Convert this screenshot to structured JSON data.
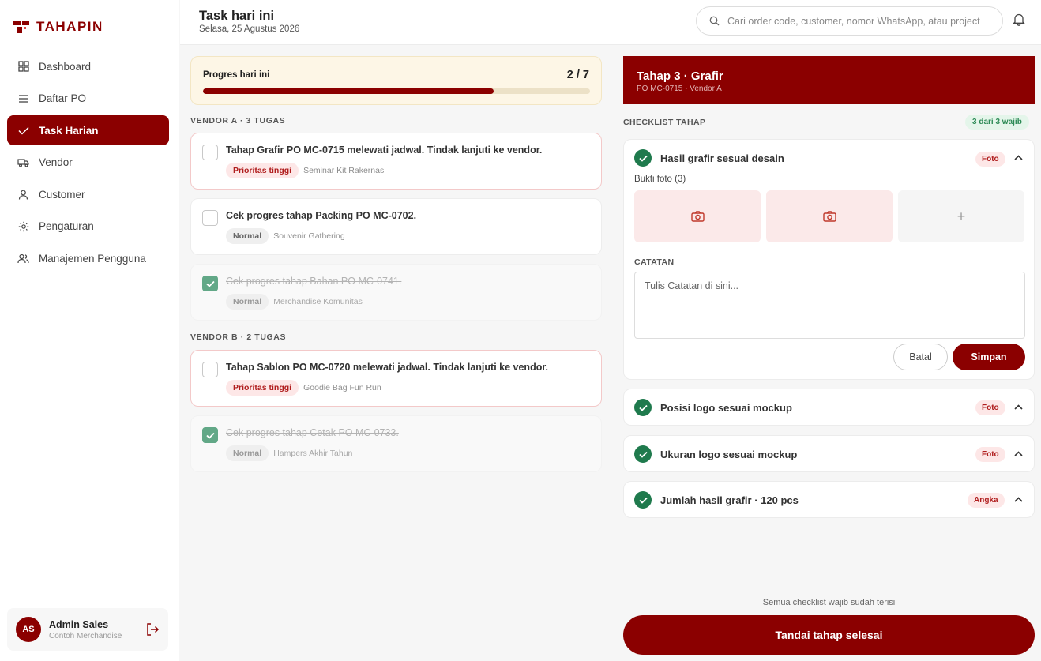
{
  "brand": {
    "name": "TAHAPIN",
    "color": "#8b0000"
  },
  "sidebar": {
    "items": [
      {
        "label": "Dashboard",
        "icon": "grid-icon"
      },
      {
        "label": "Daftar PO",
        "icon": "list-icon"
      },
      {
        "label": "Task Harian",
        "icon": "check-icon",
        "active": true
      },
      {
        "label": "Vendor",
        "icon": "truck-icon"
      },
      {
        "label": "Customer",
        "icon": "user-icon"
      },
      {
        "label": "Pengaturan",
        "icon": "gear-icon"
      },
      {
        "label": "Manajemen Pengguna",
        "icon": "users-icon"
      }
    ],
    "user": {
      "initials": "AS",
      "name": "Admin Sales",
      "org": "Contoh Merchandise"
    }
  },
  "header": {
    "title": "Task hari ini",
    "date": "Selasa, 25 Agustus 2026",
    "search_placeholder": "Cari order code, customer, nomor WhatsApp, atau project"
  },
  "progress": {
    "label": "Progres hari ini",
    "count": "2 / 7",
    "percent": 75
  },
  "task_groups": [
    {
      "label": "VENDOR A · 3 TUGAS",
      "tasks": [
        {
          "title": "Tahap Grafir PO MC-0715 melewati jadwal. Tindak lanjuti ke vendor.",
          "priority": "Prioritas tinggi",
          "project": "Seminar Kit Rakernas",
          "done": false
        },
        {
          "title": "Cek progres tahap Packing PO MC-0702.",
          "priority": "Normal",
          "project": "Souvenir Gathering",
          "done": false
        },
        {
          "title": "Cek progres tahap Bahan PO MC-0741.",
          "priority": "Normal",
          "project": "Merchandise Komunitas",
          "done": true
        }
      ]
    },
    {
      "label": "VENDOR B · 2 TUGAS",
      "tasks": [
        {
          "title": "Tahap Sablon PO MC-0720 melewati jadwal. Tindak lanjuti ke vendor.",
          "priority": "Prioritas tinggi",
          "project": "Goodie Bag Fun Run",
          "done": false
        },
        {
          "title": "Cek progres tahap Cetak PO MC-0733.",
          "priority": "Normal",
          "project": "Hampers Akhir Tahun",
          "done": true
        }
      ]
    }
  ],
  "stage": {
    "title": "Tahap 3 · Grafir",
    "subtitle": "PO MC-0715 · Vendor A",
    "checklist_label": "CHECKLIST TAHAP",
    "required_badge": "3 dari 3 wajib",
    "items": [
      {
        "label": "Hasil grafir sesuai desain",
        "type": "Foto"
      },
      {
        "label": "Posisi logo sesuai mockup",
        "type": "Foto"
      },
      {
        "label": "Ukuran logo sesuai mockup",
        "type": "Foto"
      },
      {
        "label": "Jumlah hasil grafir · 120 pcs",
        "type": "Angka"
      }
    ],
    "proof_label": "Bukti foto (3)",
    "add_label": "+",
    "notes_label": "CATATAN",
    "notes_placeholder": "Tulis Catatan di sini...",
    "cancel_label": "Batal",
    "save_label": "Simpan",
    "footer_note": "Semua checklist wajib sudah terisi",
    "finish_label": "Tandai tahap selesai"
  }
}
